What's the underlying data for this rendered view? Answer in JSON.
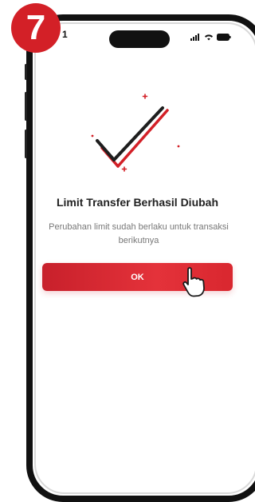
{
  "step": {
    "number": "7",
    "color": "#d32027"
  },
  "status_bar": {
    "time": "1",
    "icons": [
      "signal-icon",
      "wifi-icon",
      "battery-icon"
    ]
  },
  "success": {
    "icon": "checkmark-icon",
    "title": "Limit Transfer Berhasil Diubah",
    "subtitle": "Perubahan limit sudah berlaku untuk transaksi berikutnya"
  },
  "actions": {
    "ok_label": "OK",
    "accent": "#d32027"
  },
  "pointer": {
    "icon": "hand-pointer-icon"
  }
}
